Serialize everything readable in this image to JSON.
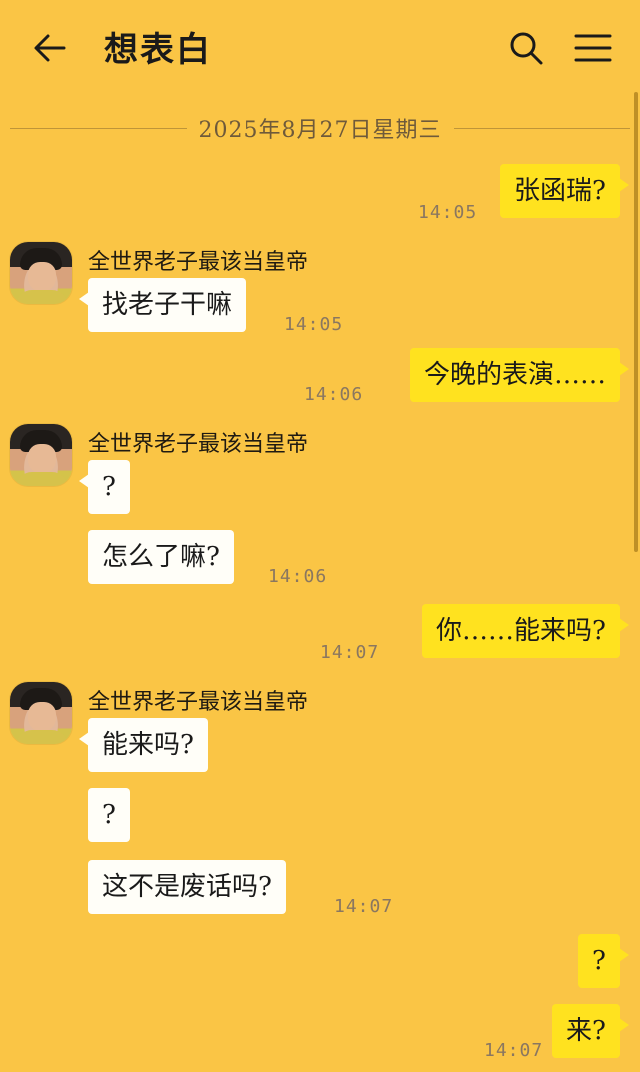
{
  "theme": {
    "background": "#fac545",
    "outgoing_bubble": "#ffe21f",
    "incoming_bubble": "#fffef8"
  },
  "header": {
    "title": "想表白",
    "back_icon": "arrow-left-icon",
    "search_icon": "search-icon",
    "menu_icon": "hamburger-menu-icon"
  },
  "date_separator": "2025年8月27日星期三",
  "contact": {
    "name": "全世界老子最该当皇帝"
  },
  "messages": {
    "m1": {
      "text": "张函瑞?",
      "time": "14:05"
    },
    "m2": {
      "text": "找老子干嘛",
      "time": "14:05"
    },
    "m3": {
      "text": "今晚的表演……",
      "time": "14:06"
    },
    "m4": {
      "text": "?"
    },
    "m5": {
      "text": "怎么了嘛?",
      "time": "14:06"
    },
    "m6": {
      "text": "你……能来吗?",
      "time": "14:07"
    },
    "m7": {
      "text": "能来吗?"
    },
    "m8": {
      "text": "?"
    },
    "m9": {
      "text": "这不是废话吗?",
      "time": "14:07"
    },
    "m10": {
      "text": "?"
    },
    "m11": {
      "text": "来?",
      "time": "14:07"
    }
  }
}
